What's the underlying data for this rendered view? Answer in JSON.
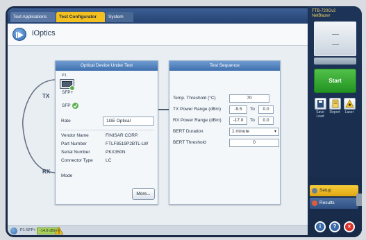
{
  "tabs": [
    {
      "label": "Test Applications"
    },
    {
      "label": "Test Configurator"
    },
    {
      "label": "System"
    }
  ],
  "page": {
    "title": "iOptics"
  },
  "cable": {
    "tx": "TX",
    "rx": "RX"
  },
  "dut_panel": {
    "header": "Optical Device Under Test",
    "port_label": "P1",
    "sfp_plus": "SFP+",
    "sfp": "SFP",
    "rows": [
      {
        "label": "Rate",
        "value": "1GE Optical"
      },
      {
        "label": "Vendor Name",
        "value": "FINISAR CORP."
      },
      {
        "label": "Part Number",
        "value": "FTLF8519P2BTL-LW"
      },
      {
        "label": "Serial Number",
        "value": "PKX350N"
      },
      {
        "label": "Connector Type",
        "value": "LC"
      },
      {
        "label": "Mode",
        "value": ""
      }
    ],
    "more_button": "More..."
  },
  "seq_panel": {
    "header": "Test Sequence",
    "temp_label": "Temp. Threshold (°C)",
    "temp_value": "70",
    "tx_label": "TX Power Range (dBm)",
    "tx_min": "-9.5",
    "tx_to": "To",
    "tx_max": "0.0",
    "rx_label": "RX Power Range (dBm)",
    "rx_min": "-17.0",
    "rx_to": "To",
    "rx_max": "0.0",
    "bert_duration_label": "BERT Duration",
    "bert_duration_value": "1 minute",
    "bert_threshold_label": "BERT Threshold",
    "bert_threshold_value": "0"
  },
  "status_bar": {
    "port": "P1-SFP+",
    "power": "-14.8 dBm"
  },
  "sidebar": {
    "model_line1": "FTB-720Gv2",
    "model_line2": "NetBlazer",
    "start": "Start",
    "actions": [
      {
        "label": "Save Load",
        "icon": "save-load-icon"
      },
      {
        "label": "Report",
        "icon": "report-icon"
      },
      {
        "label": "Laser",
        "icon": "laser-icon"
      }
    ],
    "nav": [
      {
        "label": "Setup"
      },
      {
        "label": "Results"
      }
    ]
  },
  "colors": {
    "tab_active": "#f2c11f",
    "start": "#2fa52f",
    "setup": "#f0be2a",
    "panel_header": "#4f80bf",
    "power_badge": "#a9d05c"
  }
}
